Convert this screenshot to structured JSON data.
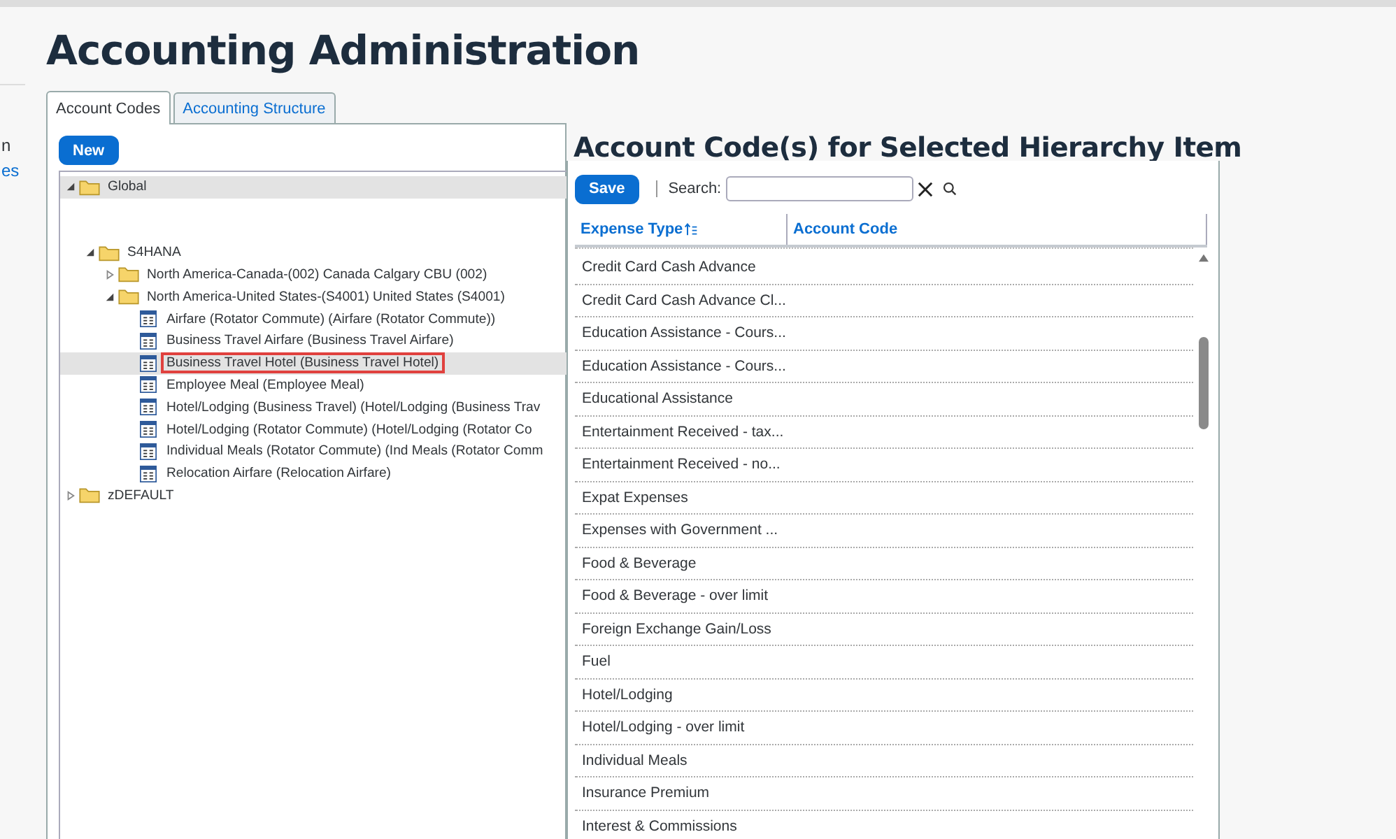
{
  "side_texts": [
    {
      "text": "n",
      "kind": "plain"
    },
    {
      "text": "es",
      "kind": "link"
    }
  ],
  "page_title": "Accounting Administration",
  "tabs": [
    {
      "label": "Account Codes",
      "selected": true
    },
    {
      "label": "Accounting Structure",
      "selected": false
    }
  ],
  "new_button": "New",
  "tree": [
    {
      "label": "Global",
      "kind": "folder",
      "expanded": true,
      "highlighted": true,
      "children": [
        {
          "label": "S4HANA",
          "kind": "folder",
          "expanded": true,
          "highlighted": false,
          "children": [
            {
              "label": "North America-Canada-(002) Canada Calgary CBU (002)",
              "kind": "folder",
              "expanded": false,
              "highlighted": false
            },
            {
              "label": "North America-United States-(S4001) United States (S4001)",
              "kind": "folder",
              "expanded": true,
              "highlighted": false,
              "children": [
                {
                  "label": "Airfare (Rotator Commute) (Airfare (Rotator Commute))",
                  "kind": "code",
                  "highlighted": false,
                  "outlined": false
                },
                {
                  "label": "Business Travel Airfare (Business Travel Airfare)",
                  "kind": "code",
                  "highlighted": false,
                  "outlined": false
                },
                {
                  "label": "Business Travel Hotel (Business Travel Hotel)",
                  "kind": "code",
                  "highlighted": true,
                  "outlined": true
                },
                {
                  "label": "Employee Meal (Employee Meal)",
                  "kind": "code",
                  "highlighted": false,
                  "outlined": false
                },
                {
                  "label": "Hotel/Lodging (Business Travel) (Hotel/Lodging (Business Trav",
                  "kind": "code",
                  "highlighted": false,
                  "outlined": false
                },
                {
                  "label": "Hotel/Lodging (Rotator Commute) (Hotel/Lodging (Rotator Co",
                  "kind": "code",
                  "highlighted": false,
                  "outlined": false
                },
                {
                  "label": "Individual Meals (Rotator Commute) (Ind Meals (Rotator Comm",
                  "kind": "code",
                  "highlighted": false,
                  "outlined": false
                },
                {
                  "label": "Relocation Airfare (Relocation Airfare)",
                  "kind": "code",
                  "highlighted": false,
                  "outlined": false
                }
              ]
            }
          ]
        }
      ]
    },
    {
      "label": "zDEFAULT",
      "kind": "folder",
      "expanded": false,
      "highlighted": false
    }
  ],
  "section_title": "Account Code(s) for Selected Hierarchy Item",
  "save_button": "Save",
  "search": {
    "label": "Search:"
  },
  "table": {
    "columns": [
      "Expense Type",
      "Account Code"
    ],
    "rows": [
      "Credit Card Cash Advance",
      "Credit Card Cash Advance Cl...",
      "Education Assistance - Cours...",
      "Education Assistance - Cours...",
      "Educational Assistance",
      "Entertainment Received - tax...",
      "Entertainment Received - no...",
      "Expat Expenses",
      "Expenses with Government ...",
      "Food & Beverage",
      "Food & Beverage - over limit",
      "Foreign Exchange Gain/Loss",
      "Fuel",
      "Hotel/Lodging",
      "Hotel/Lodging - over limit",
      "Individual Meals",
      "Insurance Premium",
      "Interest & Commissions"
    ]
  }
}
